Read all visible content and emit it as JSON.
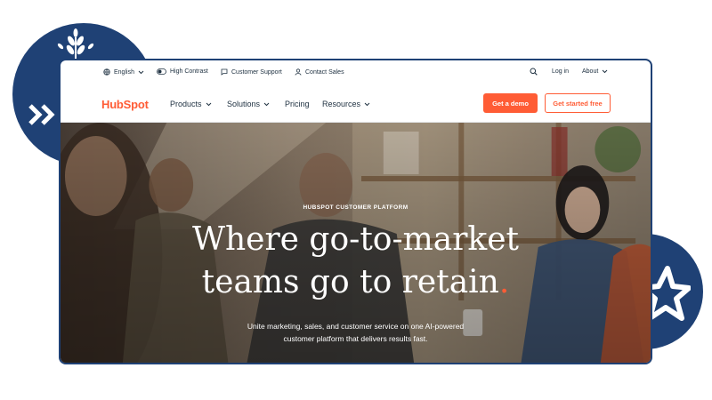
{
  "utility_bar": {
    "language": "English",
    "contrast": "High Contrast",
    "support": "Customer Support",
    "sales": "Contact Sales",
    "login": "Log in",
    "about": "About"
  },
  "nav": {
    "logo": "HubSpot",
    "items": [
      "Products",
      "Solutions",
      "Pricing",
      "Resources"
    ],
    "demo_button": "Get a demo",
    "free_button": "Get started free"
  },
  "hero": {
    "eyebrow": "HUBSPOT CUSTOMER PLATFORM",
    "headline_line1": "Where go-to-market",
    "headline_line2": "teams go to retain",
    "headline_dot": ".",
    "subtext_line1": "Unite marketing, sales, and customer service on one AI-powered",
    "subtext_line2": "customer platform that delivers results fast."
  },
  "colors": {
    "brand_orange": "#ff5c35",
    "deco_navy": "#1f4175",
    "text_dark": "#213343"
  }
}
